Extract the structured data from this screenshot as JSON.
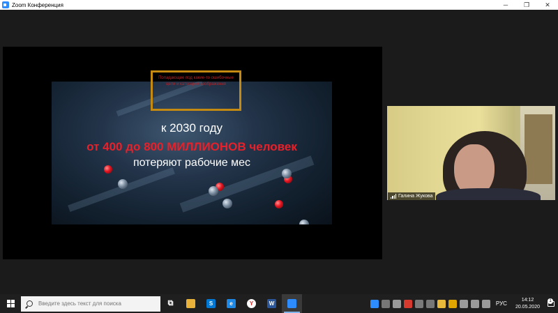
{
  "window": {
    "title": "Zoom Конференция",
    "controls": {
      "minimize": "─",
      "maximize": "❐",
      "close": "✕"
    }
  },
  "slide": {
    "line1": "к 2030 году",
    "line2": "от 400 до 800 МИЛЛИОНОВ человек",
    "line3": "потеряют рабочие мес",
    "highlight_text": "Попадающие под какие-то ошибочные цели и категории изображения"
  },
  "participant": {
    "name": "Галина Жукова"
  },
  "taskbar": {
    "search_placeholder": "Введите здесь текст для поиска",
    "apps": [
      {
        "name": "task-view-icon",
        "glyph": "⧉",
        "color": "#1f1f1f"
      },
      {
        "name": "file-explorer-icon",
        "glyph": "",
        "color": "#e8b23a"
      },
      {
        "name": "skype-icon",
        "glyph": "S",
        "color": "#0078d4"
      },
      {
        "name": "edge-icon",
        "glyph": "e",
        "color": "#1e88e5"
      },
      {
        "name": "yandex-browser-icon",
        "glyph": "Y",
        "color": "#ffffff"
      },
      {
        "name": "word-icon",
        "glyph": "W",
        "color": "#2b579a"
      },
      {
        "name": "zoom-icon",
        "glyph": "",
        "color": "#2d8cff"
      }
    ],
    "tray_icons": [
      {
        "name": "zoom-tray-icon",
        "color": "#2d8cff"
      },
      {
        "name": "usb-tray-icon",
        "color": "#777777"
      },
      {
        "name": "app-tray-icon",
        "color": "#9a9a9a"
      },
      {
        "name": "red-app-tray-icon",
        "color": "#d63a2f"
      },
      {
        "name": "headset-tray-icon",
        "color": "#7a7a7a"
      },
      {
        "name": "monitor-tray-icon",
        "color": "#777777"
      },
      {
        "name": "smile-tray-icon",
        "color": "#e9b93c"
      },
      {
        "name": "shield-tray-icon",
        "color": "#e0a500"
      },
      {
        "name": "volume-tray-icon",
        "color": "#9a9a9a"
      },
      {
        "name": "network-tray-icon",
        "color": "#9a9a9a"
      },
      {
        "name": "battery-tray-icon",
        "color": "#9a9a9a"
      }
    ],
    "language": "РУС",
    "time": "14:12",
    "date": "20.05.2020",
    "notifications": "1"
  }
}
